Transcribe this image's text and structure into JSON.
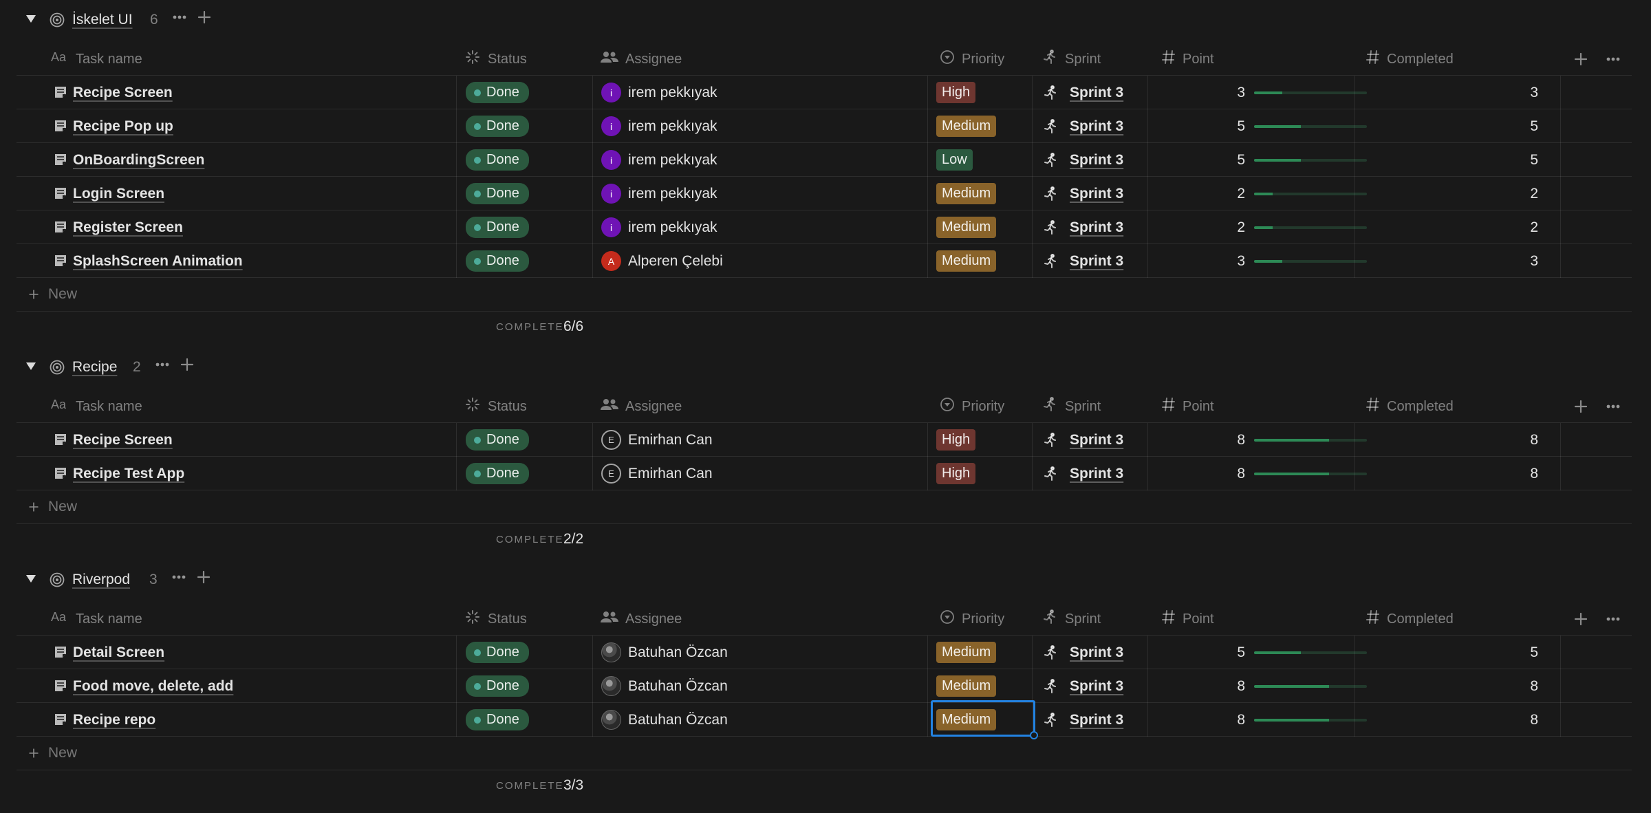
{
  "columns": {
    "task_name": "Task name",
    "status": "Status",
    "assignee": "Assignee",
    "priority": "Priority",
    "sprint": "Sprint",
    "point": "Point",
    "completed": "Completed"
  },
  "icons": {
    "group": "target-icon",
    "task": "document-icon",
    "sprint": "running-person-icon",
    "title_column": "Aa",
    "number_column": "#"
  },
  "colors": {
    "status_done": "#2b593f",
    "priority_high": "#6e3630",
    "priority_medium": "#89632a",
    "priority_low": "#2b593f",
    "progress": "#2d8a56",
    "selection": "#2383e2"
  },
  "new_label": "New",
  "calc_label": "COMPLETE",
  "progress_max": 12,
  "groups": [
    {
      "title": "İskelet UI",
      "count": "6",
      "complete": "6/6",
      "rows": [
        {
          "name": "Recipe Screen",
          "status": "Done",
          "avatar": "i",
          "avatar_style": "purple",
          "assignee": "irem pekkıyak",
          "priority": "High",
          "sprint": "Sprint 3",
          "point": "3",
          "completed": "3"
        },
        {
          "name": "Recipe Pop up",
          "status": "Done",
          "avatar": "i",
          "avatar_style": "purple",
          "assignee": "irem pekkıyak",
          "priority": "Medium",
          "sprint": "Sprint 3",
          "point": "5",
          "completed": "5"
        },
        {
          "name": "OnBoardingScreen",
          "status": "Done",
          "avatar": "i",
          "avatar_style": "purple",
          "assignee": "irem pekkıyak",
          "priority": "Low",
          "sprint": "Sprint 3",
          "point": "5",
          "completed": "5"
        },
        {
          "name": "Login Screen",
          "status": "Done",
          "avatar": "i",
          "avatar_style": "purple",
          "assignee": "irem pekkıyak",
          "priority": "Medium",
          "sprint": "Sprint 3",
          "point": "2",
          "completed": "2"
        },
        {
          "name": "Register Screen",
          "status": "Done",
          "avatar": "i",
          "avatar_style": "purple",
          "assignee": "irem pekkıyak",
          "priority": "Medium",
          "sprint": "Sprint 3",
          "point": "2",
          "completed": "2"
        },
        {
          "name": "SplashScreen Animation",
          "status": "Done",
          "avatar": "A",
          "avatar_style": "red",
          "assignee": "Alperen Çelebi",
          "priority": "Medium",
          "sprint": "Sprint 3",
          "point": "3",
          "completed": "3"
        }
      ]
    },
    {
      "title": "Recipe",
      "count": "2",
      "complete": "2/2",
      "rows": [
        {
          "name": "Recipe Screen",
          "status": "Done",
          "avatar": "E",
          "avatar_style": "outline",
          "assignee": "Emirhan Can",
          "priority": "High",
          "sprint": "Sprint 3",
          "point": "8",
          "completed": "8"
        },
        {
          "name": "Recipe Test App",
          "status": "Done",
          "avatar": "E",
          "avatar_style": "outline",
          "assignee": "Emirhan Can",
          "priority": "High",
          "sprint": "Sprint 3",
          "point": "8",
          "completed": "8"
        }
      ]
    },
    {
      "title": "Riverpod",
      "count": "3",
      "complete": "3/3",
      "rows": [
        {
          "name": "Detail Screen",
          "status": "Done",
          "avatar": "",
          "avatar_style": "photo",
          "assignee": "Batuhan Özcan",
          "priority": "Medium",
          "sprint": "Sprint 3",
          "point": "5",
          "completed": "5"
        },
        {
          "name": "Food move, delete, add",
          "status": "Done",
          "avatar": "",
          "avatar_style": "photo",
          "assignee": "Batuhan Özcan",
          "priority": "Medium",
          "sprint": "Sprint 3",
          "point": "8",
          "completed": "8"
        },
        {
          "name": "Recipe repo",
          "status": "Done",
          "avatar": "",
          "avatar_style": "photo",
          "assignee": "Batuhan Özcan",
          "priority": "Medium",
          "sprint": "Sprint 3",
          "point": "8",
          "completed": "8"
        }
      ]
    }
  ]
}
